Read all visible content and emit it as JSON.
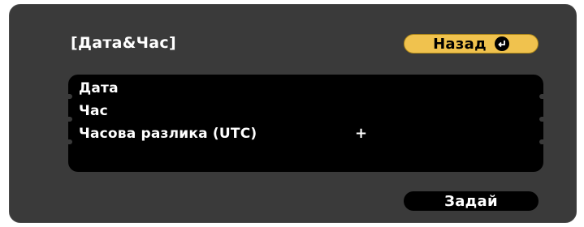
{
  "dialog": {
    "title": "[Дата&Час]",
    "back_button": {
      "label": "Назад",
      "icon": "enter-icon"
    },
    "rows": [
      {
        "label": "Дата",
        "value": ""
      },
      {
        "label": "Час",
        "value": ""
      },
      {
        "label": "Часова разлика (UTC)",
        "value": "+"
      },
      {
        "label": "",
        "value": ""
      }
    ],
    "set_button_label": "Задай"
  },
  "colors": {
    "background": "#3a3a3a",
    "panel": "#000000",
    "accent": "#f0c24e",
    "text": "#ffffff"
  }
}
